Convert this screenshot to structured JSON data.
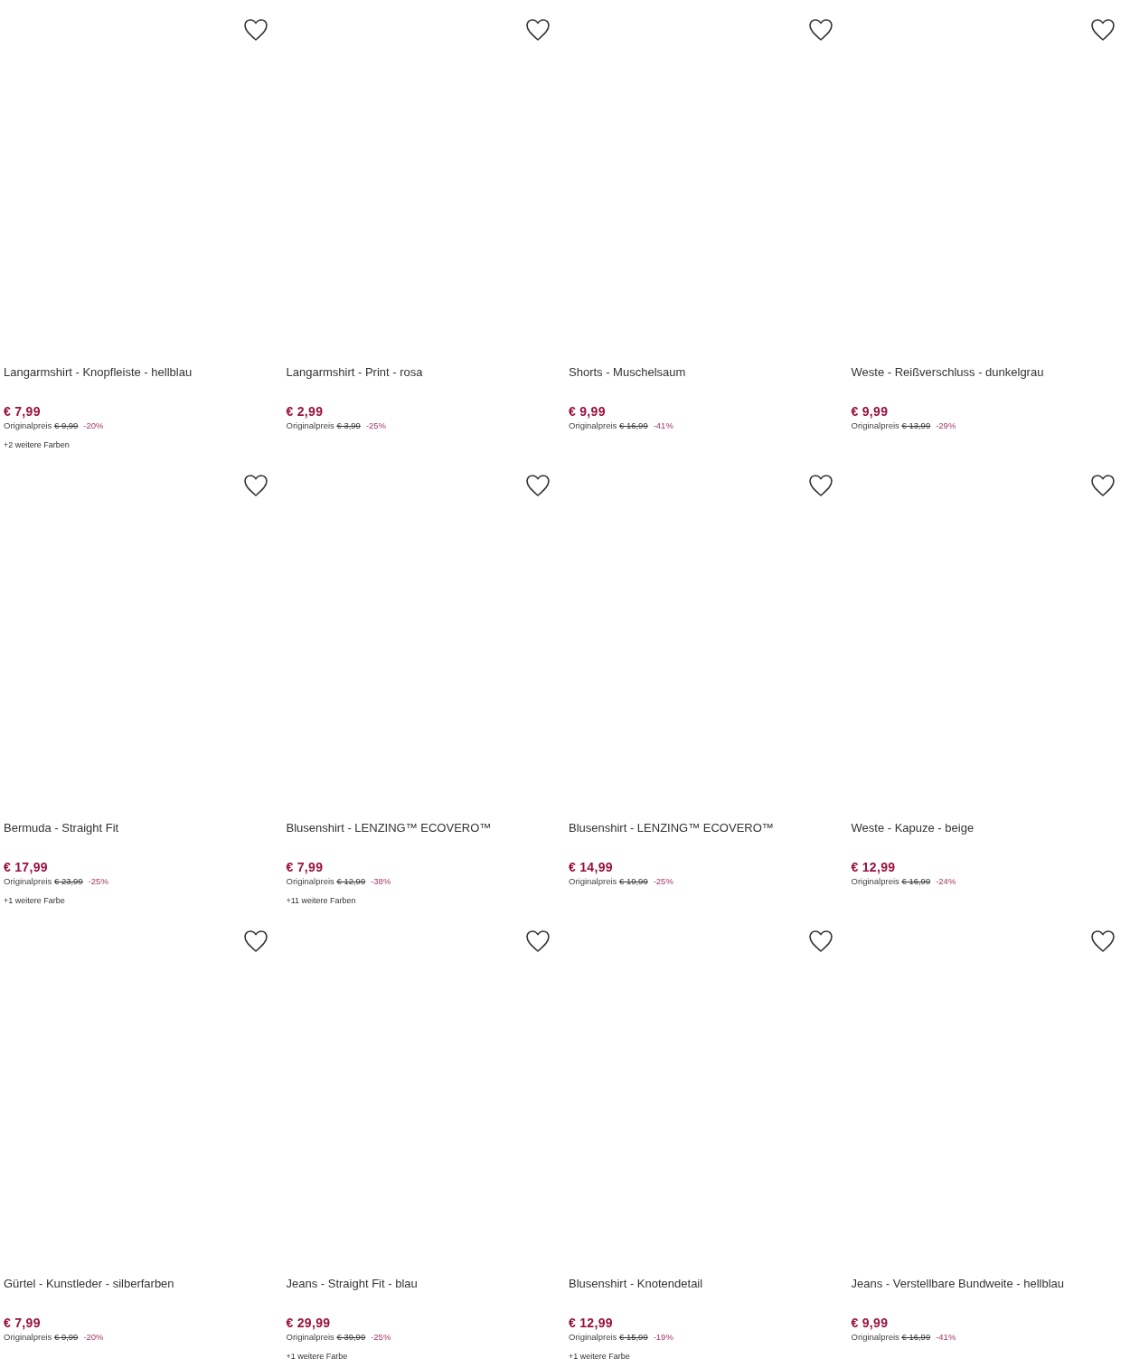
{
  "products": [
    {
      "name": "Langarmshirt - Knopfleiste - hellblau",
      "price": "€ 7,99",
      "original_label": "Originalpreis",
      "original_price": "€ 9,99",
      "discount": "-20%",
      "more_colors": "+2 weitere Farben"
    },
    {
      "name": "Langarmshirt - Print - rosa",
      "price": "€ 2,99",
      "original_label": "Originalpreis",
      "original_price": "€ 3,99",
      "discount": "-25%"
    },
    {
      "name": "Shorts - Muschelsaum",
      "price": "€ 9,99",
      "original_label": "Originalpreis",
      "original_price": "€ 16,99",
      "discount": "-41%"
    },
    {
      "name": "Weste - Reißverschluss - dunkelgrau",
      "price": "€ 9,99",
      "original_label": "Originalpreis",
      "original_price": "€ 13,99",
      "discount": "-29%"
    },
    {
      "name": "Bermuda - Straight Fit",
      "price": "€ 17,99",
      "original_label": "Originalpreis",
      "original_price": "€ 23,99",
      "discount": "-25%",
      "more_colors": "+1 weitere Farbe"
    },
    {
      "name": "Blusenshirt - LENZING™ ECOVERO™",
      "price": "€ 7,99",
      "original_label": "Originalpreis",
      "original_price": "€ 12,99",
      "discount": "-38%",
      "more_colors": "+11 weitere Farben"
    },
    {
      "name": "Blusenshirt - LENZING™ ECOVERO™",
      "price": "€ 14,99",
      "original_label": "Originalpreis",
      "original_price": "€ 19,99",
      "discount": "-25%"
    },
    {
      "name": "Weste - Kapuze - beige",
      "price": "€ 12,99",
      "original_label": "Originalpreis",
      "original_price": "€ 16,99",
      "discount": "-24%"
    },
    {
      "name": "Gürtel - Kunstleder - silberfarben",
      "price": "€ 7,99",
      "original_label": "Originalpreis",
      "original_price": "€ 9,99",
      "discount": "-20%"
    },
    {
      "name": "Jeans - Straight Fit - blau",
      "price": "€ 29,99",
      "original_label": "Originalpreis",
      "original_price": "€ 39,99",
      "discount": "-25%",
      "more_colors": "+1 weitere Farbe"
    },
    {
      "name": "Blusenshirt - Knotendetail",
      "price": "€ 12,99",
      "original_label": "Originalpreis",
      "original_price": "€ 15,99",
      "discount": "-19%",
      "more_colors": "+1 weitere Farbe"
    },
    {
      "name": "Jeans - Verstellbare Bundweite - hellblau",
      "price": "€ 9,99",
      "original_label": "Originalpreis",
      "original_price": "€ 16,99",
      "discount": "-41%"
    }
  ]
}
